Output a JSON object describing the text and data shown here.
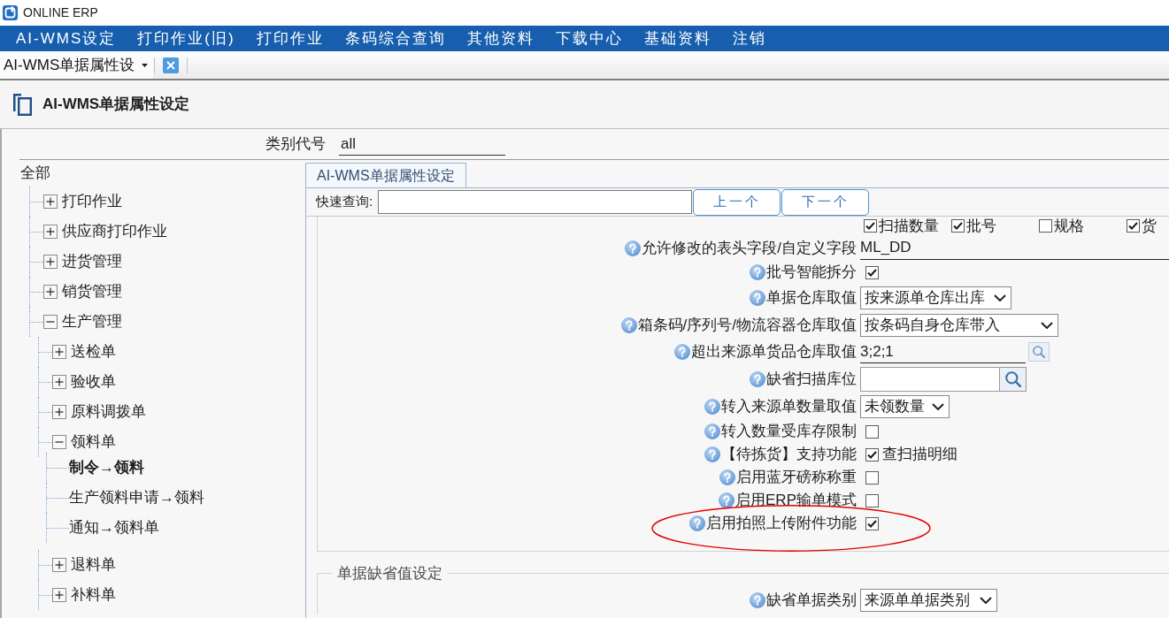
{
  "window": {
    "title": "ONLINE ERP"
  },
  "menu": [
    "AI-WMS设定",
    "打印作业(旧)",
    "打印作业",
    "条码综合查询",
    "其他资料",
    "下载中心",
    "基础资料",
    "注销"
  ],
  "tabs": [
    {
      "label": "AI-WMS单据属性设",
      "selected": true
    }
  ],
  "page": {
    "title": "AI-WMS单据属性设定"
  },
  "category": {
    "label": "类别代号",
    "value": "all"
  },
  "tree": {
    "label": "全部",
    "selected": false,
    "children": [
      {
        "label": "打印作业",
        "expanded": false,
        "selected": false
      },
      {
        "label": "供应商打印作业",
        "expanded": false,
        "selected": false
      },
      {
        "label": "进货管理",
        "expanded": false,
        "selected": false
      },
      {
        "label": "销货管理",
        "expanded": false,
        "selected": false
      },
      {
        "label": "生产管理",
        "expanded": true,
        "selected": false,
        "children": [
          {
            "label": "送检单",
            "expanded": false,
            "selected": false
          },
          {
            "label": "验收单",
            "expanded": false,
            "selected": false
          },
          {
            "label": "原料调拨单",
            "expanded": false,
            "selected": false
          },
          {
            "label": "领料单",
            "expanded": true,
            "selected": false,
            "children": [
              {
                "label": "制令→领料",
                "selected": true
              },
              {
                "label": "生产领料申请→领料",
                "selected": false
              },
              {
                "label": "通知→领料单",
                "selected": false
              }
            ]
          },
          {
            "label": "退料单",
            "expanded": false,
            "selected": false
          },
          {
            "label": "补料单",
            "expanded": false,
            "selected": false
          }
        ]
      }
    ]
  },
  "panel": {
    "tabs": [
      {
        "label": "AI-WMS单据属性设定",
        "selected": true
      }
    ],
    "quick_search": {
      "label": "快速查询:",
      "buttons": [
        "上一个",
        "下一个"
      ]
    },
    "groups": [
      {
        "rows": [
          {
            "kind": "checkgroup",
            "highlighted": false,
            "options": [
              {
                "label": "扫描数量",
                "checked": true
              },
              {
                "label": "批号",
                "checked": true
              },
              {
                "label": "规格",
                "checked": false
              },
              {
                "label": "货",
                "checked": true
              }
            ]
          },
          {
            "kind": "text",
            "highlighted": false,
            "label": "允许修改的表头字段/自定义字段",
            "value": "ML_DD"
          },
          {
            "kind": "checkbox",
            "highlighted": false,
            "label": "批号智能拆分",
            "checked": true
          },
          {
            "kind": "select",
            "highlighted": false,
            "label": "单据仓库取值",
            "value": "按来源单仓库出库"
          },
          {
            "kind": "select",
            "highlighted": false,
            "label": "箱条码/序列号/物流容器仓库取值",
            "value": "按条码自身仓库带入"
          },
          {
            "kind": "lookup",
            "highlighted": false,
            "label": "超出来源单货品仓库取值",
            "value": "3;2;1"
          },
          {
            "kind": "search",
            "highlighted": false,
            "label": "缺省扫描库位"
          },
          {
            "kind": "select",
            "highlighted": false,
            "label": "转入来源单数量取值",
            "value": "未领数量"
          },
          {
            "kind": "checkbox",
            "highlighted": false,
            "label": "转入数量受库存限制",
            "checked": false
          },
          {
            "kind": "checkbox",
            "highlighted": false,
            "label": "【待拣货】支持功能",
            "checked": true,
            "option": "查扫描明细"
          },
          {
            "kind": "checkbox",
            "highlighted": false,
            "label": "启用蓝牙磅称称重",
            "checked": false
          },
          {
            "kind": "checkbox",
            "highlighted": false,
            "label": "启用ERP输单模式",
            "checked": false
          },
          {
            "kind": "checkbox",
            "highlighted": true,
            "label": "启用拍照上传附件功能",
            "checked": true
          }
        ]
      },
      {
        "title": "单据缺省值设定",
        "rows": [
          {
            "kind": "select",
            "highlighted": false,
            "label": "缺省单据类别",
            "value": "来源单单据类别"
          }
        ]
      }
    ]
  }
}
